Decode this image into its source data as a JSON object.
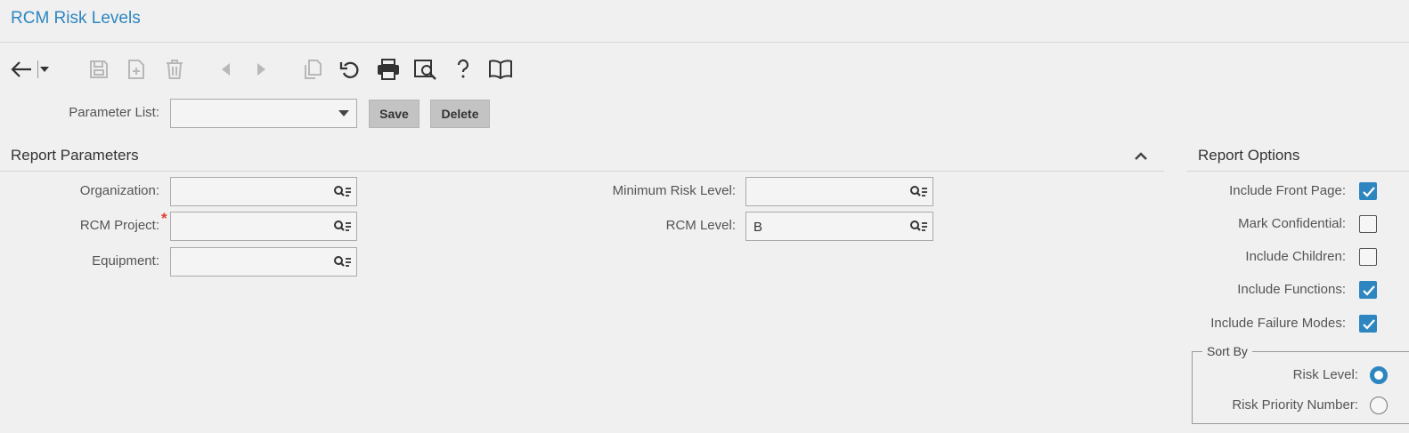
{
  "page": {
    "title": "RCM Risk Levels"
  },
  "toolbar": {
    "icons": [
      "back-arrow-icon",
      "chevron-down-icon",
      "save-icon",
      "new-record-icon",
      "delete-icon",
      "previous-icon",
      "next-icon",
      "copy-icon",
      "refresh-icon",
      "print-icon",
      "print-preview-icon",
      "help-icon",
      "book-icon"
    ]
  },
  "parameter_list": {
    "label": "Parameter List:",
    "value": "",
    "save_label": "Save",
    "delete_label": "Delete"
  },
  "report_parameters": {
    "title": "Report Parameters",
    "organization": {
      "label": "Organization:",
      "value": ""
    },
    "rcm_project": {
      "label": "RCM Project:",
      "value": "",
      "required_mark": "*"
    },
    "equipment": {
      "label": "Equipment:",
      "value": ""
    },
    "minimum_risk_level": {
      "label": "Minimum Risk Level:",
      "value": ""
    },
    "rcm_level": {
      "label": "RCM Level:",
      "value": "B"
    }
  },
  "report_options": {
    "title": "Report Options",
    "include_front_page": {
      "label": "Include Front Page:",
      "checked": true
    },
    "mark_confidential": {
      "label": "Mark Confidential:",
      "checked": false
    },
    "include_children": {
      "label": "Include Children:",
      "checked": false
    },
    "include_functions": {
      "label": "Include Functions:",
      "checked": true
    },
    "include_failure_modes": {
      "label": "Include Failure Modes:",
      "checked": true
    },
    "sort_by": {
      "legend": "Sort By",
      "risk_level": {
        "label": "Risk Level:",
        "selected": true
      },
      "risk_priority_number": {
        "label": "Risk Priority Number:",
        "selected": false
      }
    }
  },
  "colors": {
    "accent": "#2e86c1",
    "required": "#e03c31",
    "disabled_icon": "#b8b8b8",
    "active_icon": "#333333"
  }
}
